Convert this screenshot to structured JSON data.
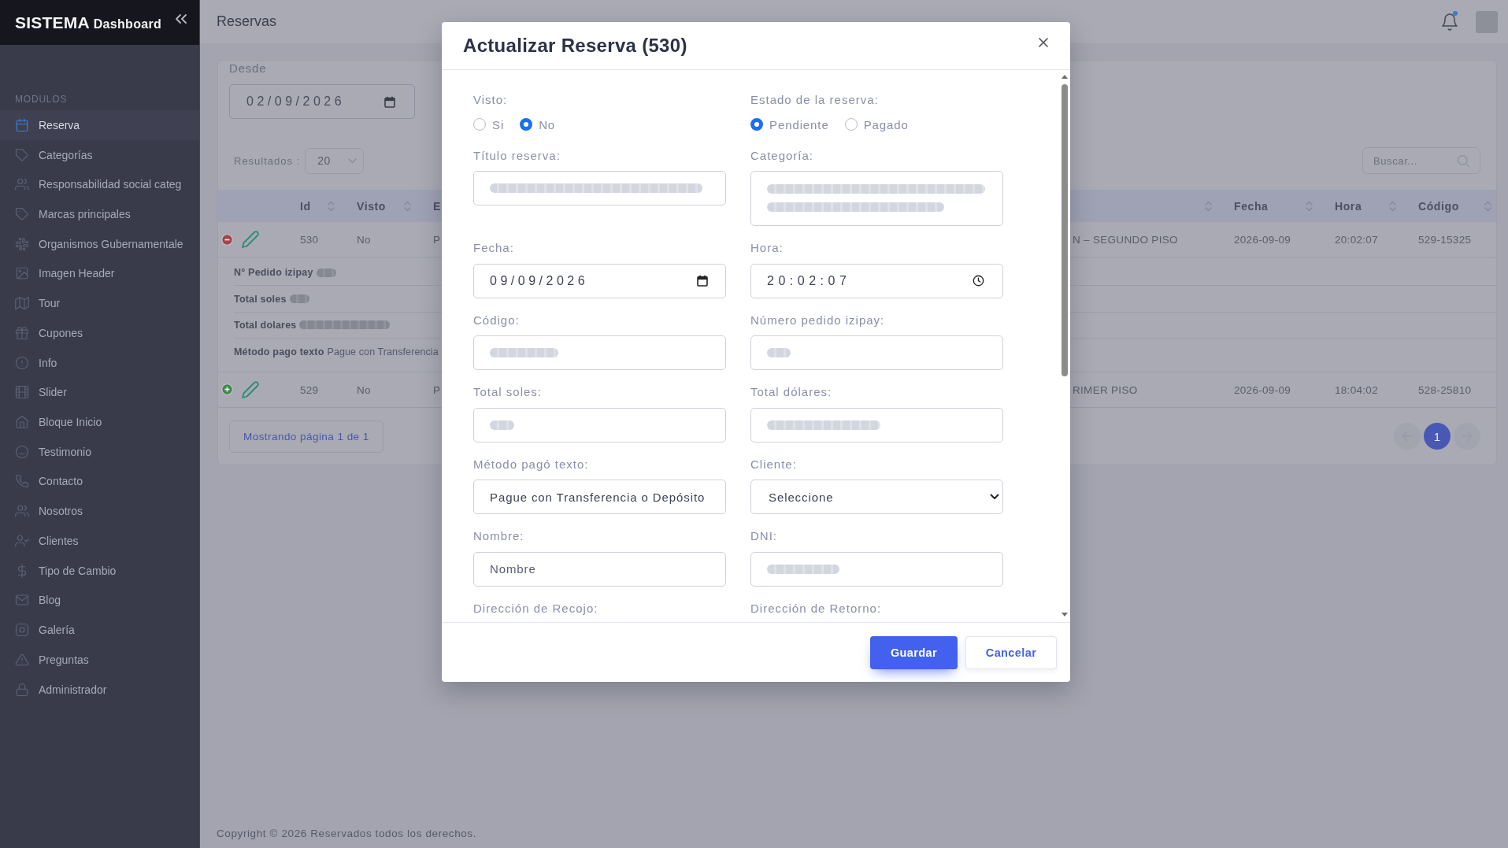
{
  "sidebar": {
    "brand": "SISTEMA",
    "brand_suffix": "Dashboard",
    "section": "MODULOS",
    "items": [
      {
        "label": "Reserva",
        "selected": true
      },
      {
        "label": "Categorías",
        "selected": false
      },
      {
        "label": "Responsabilidad social categ",
        "selected": false
      },
      {
        "label": "Marcas principales",
        "selected": false
      },
      {
        "label": "Organismos Gubernamentale",
        "selected": false
      },
      {
        "label": "Imagen Header",
        "selected": false
      },
      {
        "label": "Tour",
        "selected": false
      },
      {
        "label": "Cupones",
        "selected": false
      },
      {
        "label": "Info",
        "selected": false
      },
      {
        "label": "Slider",
        "selected": false
      },
      {
        "label": "Bloque Inicio",
        "selected": false
      },
      {
        "label": "Testimonio",
        "selected": false
      },
      {
        "label": "Contacto",
        "selected": false
      },
      {
        "label": "Nosotros",
        "selected": false
      },
      {
        "label": "Clientes",
        "selected": false
      },
      {
        "label": "Tipo de Cambio",
        "selected": false
      },
      {
        "label": "Blog",
        "selected": false
      },
      {
        "label": "Galería",
        "selected": false
      },
      {
        "label": "Preguntas",
        "selected": false
      },
      {
        "label": "Administrador",
        "selected": false
      }
    ]
  },
  "header": {
    "title": "Reservas",
    "unread": true
  },
  "filters": {
    "from_label": "Desde",
    "from_value": "02/09/2026",
    "results_label": "Resultados :",
    "results_value": "20",
    "search_placeholder": "Buscar..."
  },
  "table": {
    "columns": [
      {
        "label": "Id",
        "sortable": true
      },
      {
        "label": "Visto",
        "sortable": true
      },
      {
        "label": "E"
      },
      {
        "sortable": true
      },
      {
        "label": "Fecha",
        "sortable": true
      },
      {
        "label": "Hora",
        "sortable": true
      },
      {
        "label": "Código",
        "sortable": true
      }
    ],
    "rows": [
      {
        "expanded": true,
        "cells": [
          "530",
          "No",
          "P",
          "N – SEGUNDO PISO",
          "2026-09-09",
          "20:02:07",
          "529-15325"
        ],
        "details": [
          {
            "label": "N° Pedido izipay",
            "redacted": true
          },
          {
            "label": "Total soles",
            "redacted": true
          },
          {
            "label": "Total dolares",
            "redacted": true
          },
          {
            "label": "Método pago texto",
            "value": "Pague con Transferencia"
          }
        ]
      },
      {
        "expanded": false,
        "cells": [
          "529",
          "No",
          "P",
          "RIMER PISO",
          "2026-09-09",
          "18:04:02",
          "528-25810"
        ]
      }
    ]
  },
  "pagination": {
    "summary": "Mostrando página 1 de 1",
    "pages": [
      {
        "label": "1",
        "selected": true
      }
    ]
  },
  "footer": {
    "copyright": "Copyright © 2026 Reservados todos los derechos."
  },
  "modal": {
    "title": "Actualizar Reserva (530)",
    "fields": [
      {
        "kind": "radio",
        "label": "Visto:",
        "options": [
          {
            "label": "Si",
            "selected": false
          },
          {
            "label": "No",
            "selected": true
          }
        ]
      },
      {
        "kind": "radio",
        "label": "Estado de la reserva:",
        "options": [
          {
            "label": "Pendiente",
            "selected": true
          },
          {
            "label": "Pagado",
            "selected": false
          }
        ]
      },
      {
        "kind": "text",
        "label": "Título reserva:",
        "redacted": true
      },
      {
        "kind": "textarea",
        "label": "Categoría:",
        "redacted": true
      },
      {
        "kind": "date",
        "label": "Fecha:",
        "value": "09/09/2026"
      },
      {
        "kind": "time",
        "label": "Hora:",
        "value": "20:02:07"
      },
      {
        "kind": "text",
        "label": "Código:",
        "redacted": true
      },
      {
        "kind": "text",
        "label": "Número pedido izipay:",
        "redacted": true
      },
      {
        "kind": "text",
        "label": "Total soles:",
        "redacted": true
      },
      {
        "kind": "text",
        "label": "Total dólares:",
        "redacted": true
      },
      {
        "kind": "text",
        "label": "Método pagó texto:",
        "value": "Pague con Transferencia o Depósito"
      },
      {
        "kind": "select",
        "label": "Cliente:",
        "value": "Seleccione"
      },
      {
        "kind": "text",
        "label": "Nombre:",
        "placeholder": "Nombre"
      },
      {
        "kind": "text",
        "label": "DNI:",
        "redacted": true
      },
      {
        "kind": "cut_off",
        "label": "Dirección de Recojo:"
      },
      {
        "kind": "cut_off",
        "label": "Dirección de Retorno:"
      }
    ],
    "buttons": [
      {
        "label": "Guardar",
        "kind": "primary"
      },
      {
        "label": "Cancelar",
        "kind": "secondary"
      }
    ]
  }
}
